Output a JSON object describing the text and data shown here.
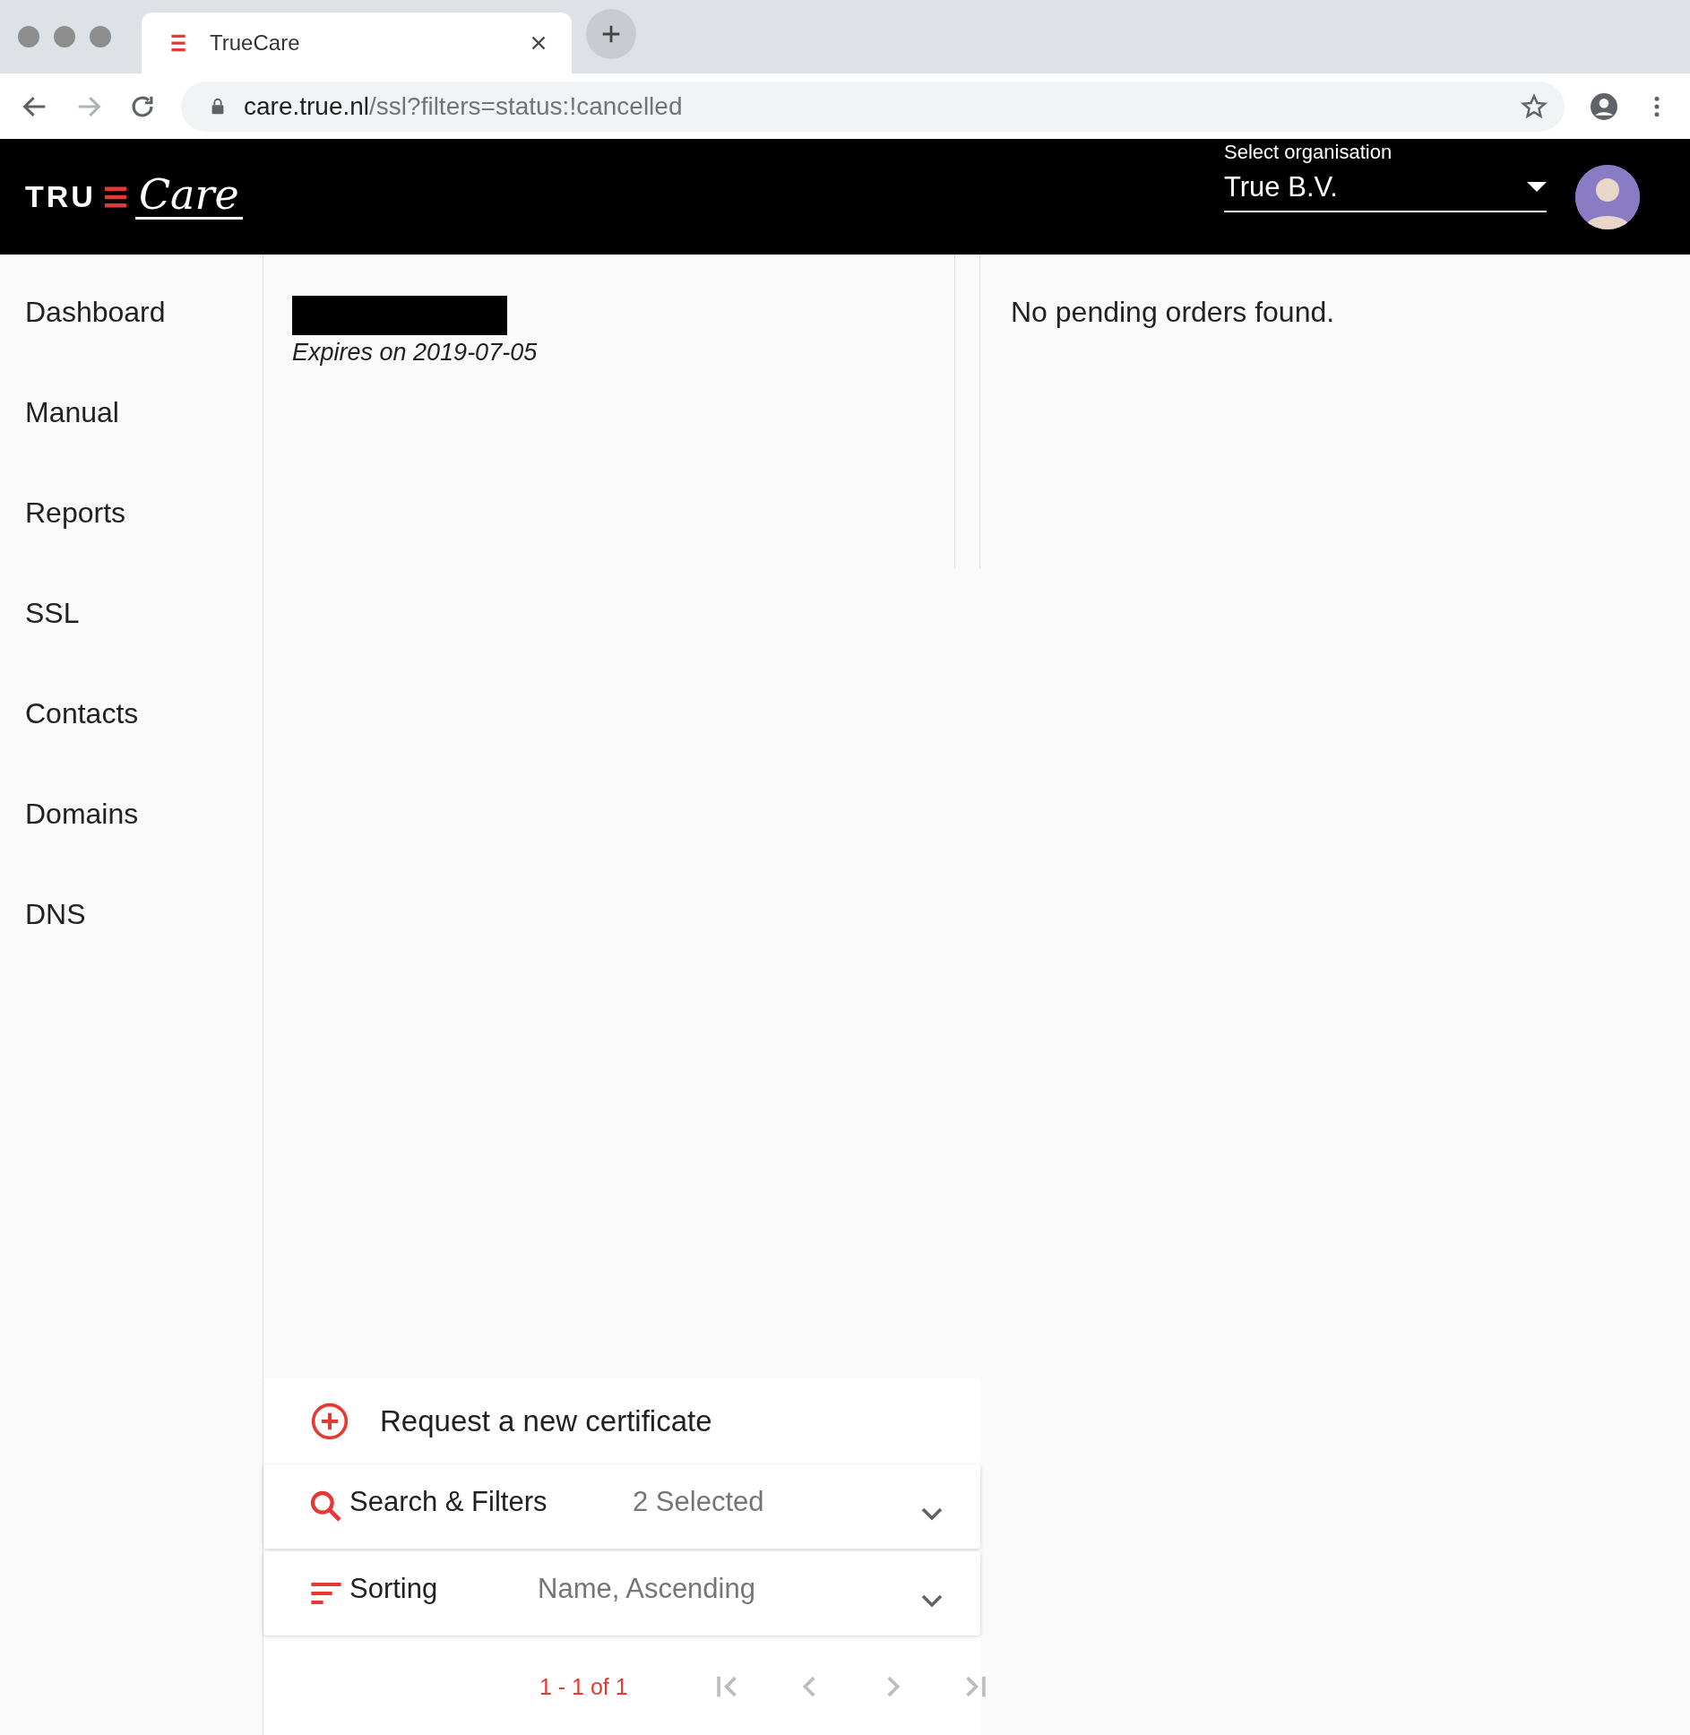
{
  "browser": {
    "tab": {
      "title": "TrueCare"
    },
    "url": {
      "host": "care.true.nl",
      "path": "/ssl?filters=status:!cancelled"
    }
  },
  "header": {
    "logo": {
      "left": "TRU",
      "right": "Care"
    },
    "org_select": {
      "label": "Select organisation",
      "value": "True B.V."
    }
  },
  "sidebar": {
    "items": [
      {
        "label": "Dashboard"
      },
      {
        "label": "Manual"
      },
      {
        "label": "Reports"
      },
      {
        "label": "SSL"
      },
      {
        "label": "Contacts"
      },
      {
        "label": "Domains"
      },
      {
        "label": "DNS"
      }
    ]
  },
  "certificates": [
    {
      "expires": "Expires on 2019-07-05"
    }
  ],
  "orders": {
    "empty_message": "No pending orders found."
  },
  "actions": {
    "request": "Request a new certificate",
    "panels": [
      {
        "kind": "search",
        "title": "Search & Filters",
        "summary": "2 Selected",
        "expanded": false
      },
      {
        "kind": "sort",
        "title": "Sorting",
        "summary": "Name, Ascending",
        "expanded": false
      }
    ]
  },
  "pagination": {
    "range": "1 - 1 of 1"
  }
}
